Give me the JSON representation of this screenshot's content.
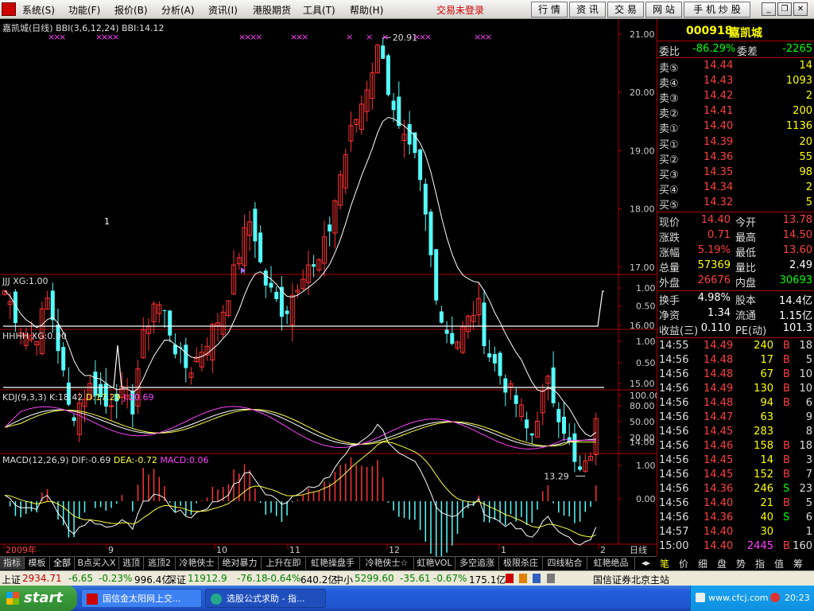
{
  "menu": {
    "items": [
      "系统(S)",
      "功能(F)",
      "报价(B)",
      "分析(A)",
      "资讯(I)",
      "港股期货",
      "工具(T)",
      "帮助(H)"
    ],
    "trade_status": "交易未登录",
    "right_buttons": [
      "行 情",
      "资 讯",
      "交 易",
      "网 站",
      "手 机 炒 股"
    ]
  },
  "main_chart": {
    "title": "嘉凯城(日线)",
    "indicator": "BBI(3,6,12,24)",
    "bbi": "BBI:14.12",
    "yticks": [
      "21.00",
      "20.00",
      "19.00",
      "18.00",
      "17.00",
      "16.00",
      "15.00",
      "14.00"
    ],
    "high_label": "20.91",
    "low_label": "13.29",
    "marker_label": "1"
  },
  "panels": {
    "jjj": {
      "title": "JJJ XG:1.00",
      "yticks": [
        "1.00",
        "0.50"
      ]
    },
    "hhhh": {
      "title": "HHHH XG:0.00",
      "yticks": [
        "1.00",
        "0.50"
      ]
    },
    "kdj": {
      "title": "KDJ(9,3,3)",
      "k": "K:18.42",
      "d": "D:17.29",
      "j": "J:20.69",
      "yticks": [
        "100.00",
        "80.00",
        "50.00",
        "20.00"
      ]
    },
    "macd": {
      "title": "MACD(12,26,9)",
      "dif": "DIF:-0.69",
      "dea": "DEA:-0.72",
      "macd": "MACD:0.06",
      "yticks": [
        "1.00",
        "0.00"
      ]
    }
  },
  "xaxis": {
    "labels": [
      "2009年",
      "9",
      "10",
      "11",
      "12",
      "1",
      "2"
    ],
    "period": "日线"
  },
  "bottom_tabs": [
    "指标",
    "模板",
    "全部",
    "B点买入X",
    "逃顶",
    "逃顶2",
    "冷艳侠士",
    "绝对暴力",
    "上升在即",
    "虹艳操盘手",
    "冷艳侠士☆",
    "虹艳VOL",
    "多空追涨",
    "极限杀庄",
    "四线粘合",
    "虹艳绝品"
  ],
  "quote": {
    "code": "000918",
    "name": "嘉凯城",
    "weibi_label": "委比",
    "weibi": "-86.29%",
    "weicha_label": "委差",
    "weicha": "-2265",
    "asks": [
      {
        "label": "卖⑤",
        "price": "14.44",
        "vol": "14"
      },
      {
        "label": "卖④",
        "price": "14.43",
        "vol": "1093"
      },
      {
        "label": "卖③",
        "price": "14.42",
        "vol": "2"
      },
      {
        "label": "卖②",
        "price": "14.41",
        "vol": "200"
      },
      {
        "label": "卖①",
        "price": "14.40",
        "vol": "1136"
      }
    ],
    "bids": [
      {
        "label": "买①",
        "price": "14.39",
        "vol": "20"
      },
      {
        "label": "买②",
        "price": "14.36",
        "vol": "55"
      },
      {
        "label": "买③",
        "price": "14.35",
        "vol": "98"
      },
      {
        "label": "买④",
        "price": "14.34",
        "vol": "2"
      },
      {
        "label": "买⑤",
        "price": "14.32",
        "vol": "5"
      }
    ],
    "stats": [
      {
        "l1": "现价",
        "v1": "14.40",
        "l2": "今开",
        "v2": "13.78",
        "c1": "#ff4040",
        "c2": "#ff4040"
      },
      {
        "l1": "涨跌",
        "v1": "0.71",
        "l2": "最高",
        "v2": "14.50",
        "c1": "#ff4040",
        "c2": "#ff4040"
      },
      {
        "l1": "涨幅",
        "v1": "5.19%",
        "l2": "最低",
        "v2": "13.60",
        "c1": "#ff4040",
        "c2": "#ff4040"
      },
      {
        "l1": "总量",
        "v1": "57369",
        "l2": "量比",
        "v2": "2.49",
        "c1": "#ffff00",
        "c2": "#ffffff"
      },
      {
        "l1": "外盘",
        "v1": "26676",
        "l2": "内盘",
        "v2": "30693",
        "c1": "#ff4040",
        "c2": "#00ff00"
      }
    ],
    "fund": [
      {
        "l1": "换手",
        "v1": "4.98%",
        "l2": "股本",
        "v2": "14.4亿"
      },
      {
        "l1": "净资",
        "v1": "1.34",
        "l2": "流通",
        "v2": "1.15亿"
      },
      {
        "l1": "收益(三)",
        "v1": "0.110",
        "l2": "PE(动)",
        "v2": "101.3"
      }
    ],
    "ticks": [
      {
        "t": "14:55",
        "p": "14.49",
        "v": "240",
        "s": "B",
        "n": "18"
      },
      {
        "t": "14:56",
        "p": "14.48",
        "v": "17",
        "s": "B",
        "n": "5"
      },
      {
        "t": "14:56",
        "p": "14.48",
        "v": "67",
        "s": "B",
        "n": "10"
      },
      {
        "t": "14:56",
        "p": "14.49",
        "v": "130",
        "s": "B",
        "n": "10"
      },
      {
        "t": "14:56",
        "p": "14.48",
        "v": "94",
        "s": "B",
        "n": "6"
      },
      {
        "t": "14:56",
        "p": "14.47",
        "v": "63",
        "s": "",
        "n": "9"
      },
      {
        "t": "14:56",
        "p": "14.45",
        "v": "283",
        "s": "",
        "n": "8"
      },
      {
        "t": "14:56",
        "p": "14.46",
        "v": "158",
        "s": "B",
        "n": "18"
      },
      {
        "t": "14:56",
        "p": "14.45",
        "v": "14",
        "s": "B",
        "n": "3"
      },
      {
        "t": "14:56",
        "p": "14.45",
        "v": "152",
        "s": "B",
        "n": "7"
      },
      {
        "t": "14:56",
        "p": "14.36",
        "v": "246",
        "s": "S",
        "n": "23"
      },
      {
        "t": "14:56",
        "p": "14.40",
        "v": "21",
        "s": "B",
        "n": "5"
      },
      {
        "t": "14:56",
        "p": "14.36",
        "v": "40",
        "s": "S",
        "n": "6"
      },
      {
        "t": "14:57",
        "p": "14.40",
        "v": "30",
        "s": "",
        "n": "1"
      },
      {
        "t": "15:00",
        "p": "14.40",
        "v": "2445",
        "s": "B",
        "n": "160"
      }
    ],
    "tabs": [
      "笔",
      "价",
      "细",
      "盘",
      "势",
      "指",
      "值",
      "筹"
    ]
  },
  "status": {
    "sh_label": "上证",
    "sh": "2934.71",
    "sh_chg": "-6.65",
    "sh_pct": "-0.23%",
    "sh_amt": "996.4亿",
    "sz_label": "深证",
    "sz": "11912.9",
    "sz_chg": "-76.18",
    "sz_pct": "-0.64%",
    "sz_amt": "640.2亿",
    "zx_label": "中小",
    "zx": "5299.60",
    "zx_chg": "-35.61",
    "zx_pct": "-0.67%",
    "zx_amt": "175.1亿",
    "server": "国信证券北京主站"
  },
  "taskbar": {
    "start": "start",
    "tasks": [
      "国信金太阳网上交...",
      "选股公式求助 - 指..."
    ],
    "tray_text": "www.cfcj.com",
    "clock": "20:23"
  }
}
